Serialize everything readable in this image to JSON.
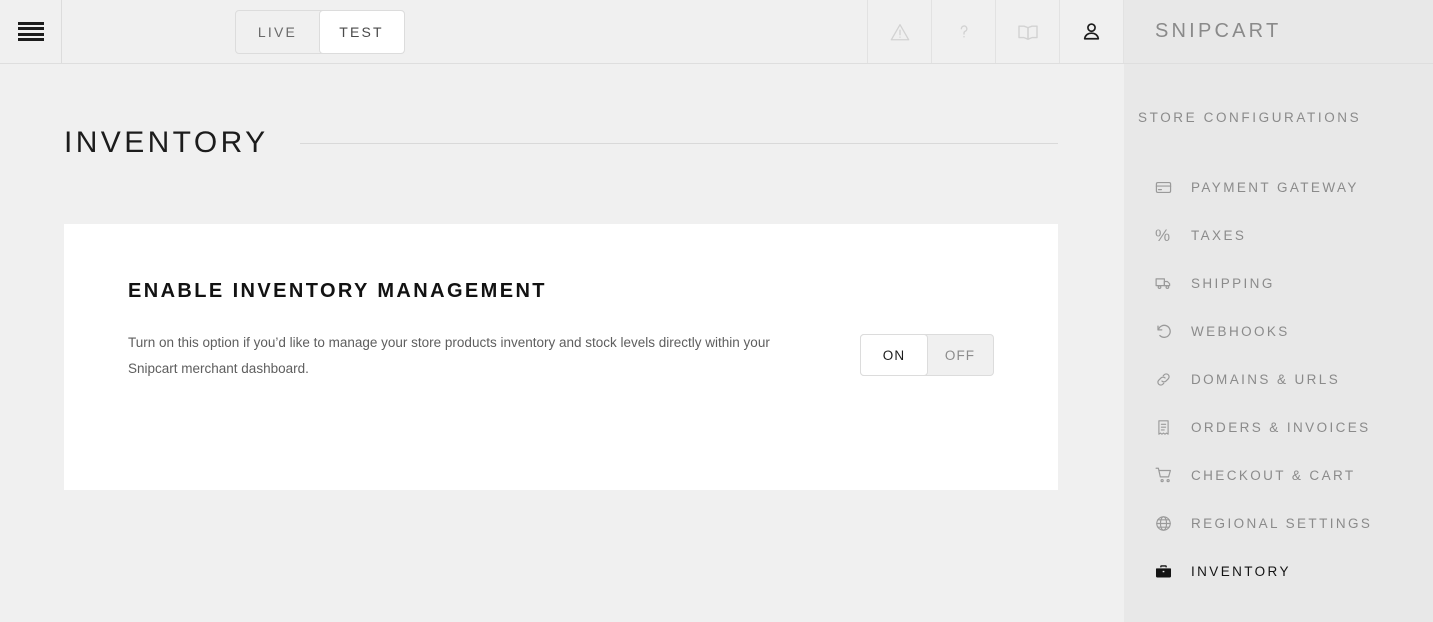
{
  "colors": {
    "page_background": "#f0f0f0",
    "sidebar_background": "#e8e8e8",
    "card_background": "#ffffff",
    "muted_text": "#8b8b8b",
    "active_text": "#141414",
    "border": "#dcdcdc"
  },
  "topbar": {
    "menu_icon": "hamburger-icon",
    "mode_toggle": {
      "options": [
        {
          "label": "LIVE",
          "active": false
        },
        {
          "label": "TEST",
          "active": true
        }
      ],
      "selected": "TEST"
    },
    "icons": [
      {
        "name": "warning-icon",
        "active": false
      },
      {
        "name": "help-icon",
        "active": false
      },
      {
        "name": "docs-icon",
        "active": false
      },
      {
        "name": "account-icon",
        "active": true
      }
    ],
    "brand": "SNIPCART"
  },
  "sidebar": {
    "title": "STORE CONFIGURATIONS",
    "items": [
      {
        "label": "PAYMENT GATEWAY",
        "icon": "credit-card-icon",
        "active": false
      },
      {
        "label": "TAXES",
        "icon": "percent-icon",
        "active": false
      },
      {
        "label": "SHIPPING",
        "icon": "truck-icon",
        "active": false
      },
      {
        "label": "WEBHOOKS",
        "icon": "undo-arrow-icon",
        "active": false
      },
      {
        "label": "DOMAINS & URLS",
        "icon": "link-icon",
        "active": false
      },
      {
        "label": "ORDERS & INVOICES",
        "icon": "receipt-icon",
        "active": false
      },
      {
        "label": "CHECKOUT & CART",
        "icon": "cart-icon",
        "active": false
      },
      {
        "label": "REGIONAL SETTINGS",
        "icon": "globe-icon",
        "active": false
      },
      {
        "label": "INVENTORY",
        "icon": "briefcase-icon",
        "active": true
      }
    ]
  },
  "main": {
    "page_title": "INVENTORY",
    "card": {
      "title": "ENABLE INVENTORY MANAGEMENT",
      "description": "Turn on this option if you’d like to manage your store products inventory and stock levels directly within your Snipcart merchant dashboard.",
      "toggle": {
        "options": [
          {
            "label": "ON",
            "active": true
          },
          {
            "label": "OFF",
            "active": false
          }
        ],
        "selected": "ON"
      }
    }
  }
}
